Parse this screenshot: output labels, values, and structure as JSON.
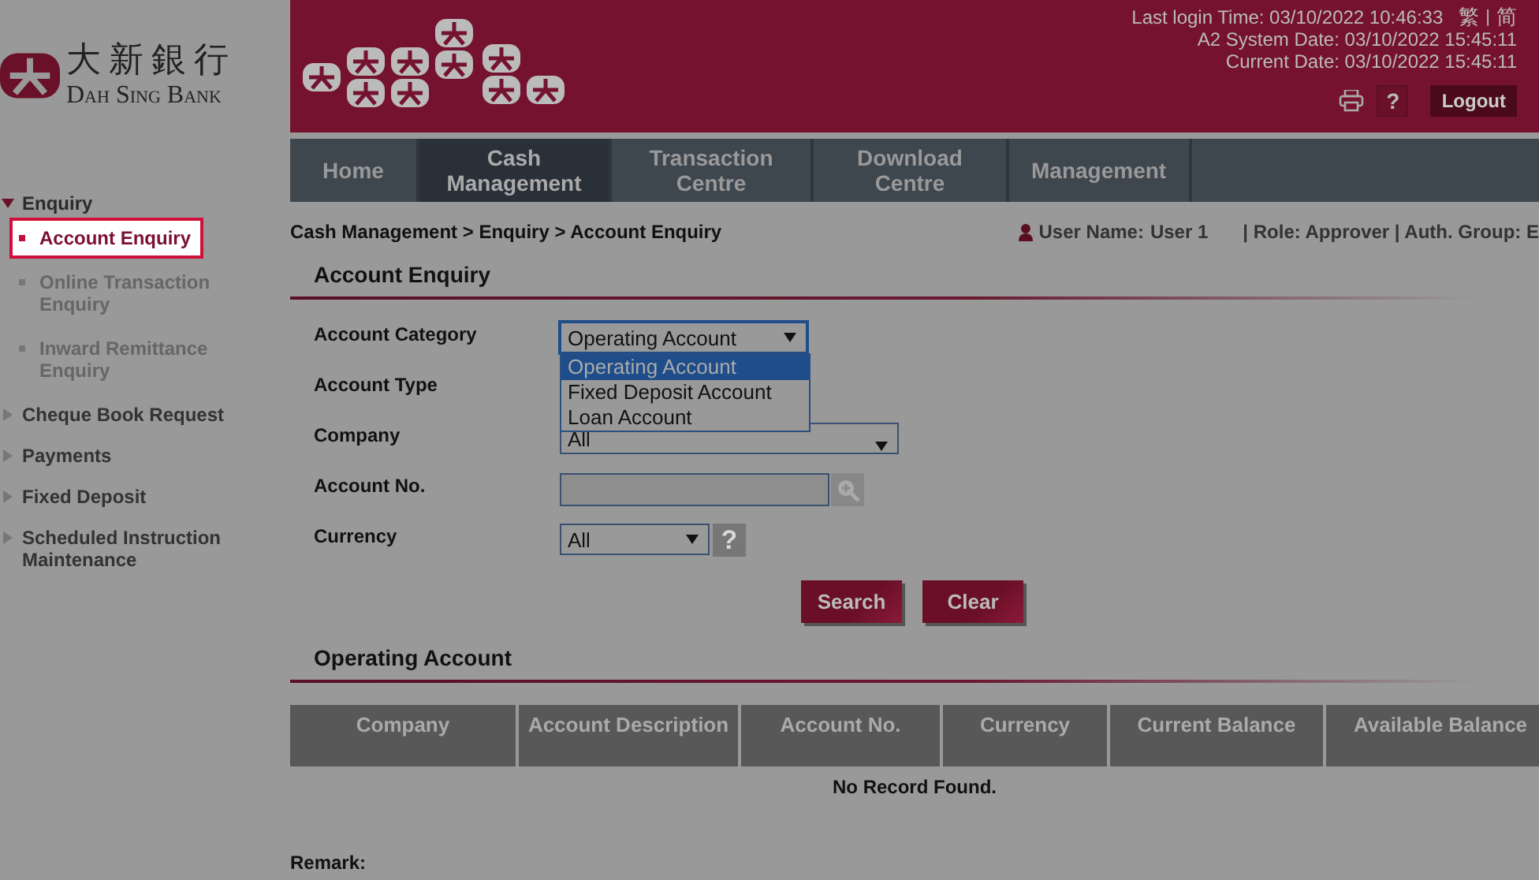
{
  "logo": {
    "chinese": "大新銀行",
    "english": "Dah Sing Bank"
  },
  "header": {
    "info": [
      "Last login Time: 03/10/2022 10:46:33",
      "A2 System Date: 03/10/2022 15:45:11",
      "Current Date: 03/10/2022 15:45:11"
    ],
    "languages": [
      "繁",
      "简"
    ],
    "language_separator": "|",
    "help": "?",
    "logout": "Logout"
  },
  "nav": [
    {
      "label": "Home",
      "selected": false
    },
    {
      "label": "Cash Management",
      "selected": true
    },
    {
      "label": "Transaction Centre",
      "selected": false
    },
    {
      "label": "Download Centre",
      "selected": false
    },
    {
      "label": "Management",
      "selected": false
    }
  ],
  "sidebar": {
    "items": [
      {
        "label": "Enquiry",
        "expanded": true,
        "children": [
          {
            "label": "Account Enquiry",
            "selected": true
          },
          {
            "label": "Online Transaction Enquiry",
            "selected": false
          },
          {
            "label": "Inward Remittance Enquiry",
            "selected": false
          }
        ]
      },
      {
        "label": "Cheque Book Request",
        "expanded": false
      },
      {
        "label": "Payments",
        "expanded": false
      },
      {
        "label": "Fixed Deposit",
        "expanded": false
      },
      {
        "label": "Scheduled Instruction Maintenance",
        "expanded": false
      }
    ]
  },
  "breadcrumb": "Cash Management > Enquiry > Account Enquiry",
  "user": {
    "label": "User Name:",
    "name": "User 1",
    "role": "| Role: Approver | Auth. Group: E"
  },
  "form": {
    "title": "Account Enquiry",
    "fields": [
      {
        "label": "Account Category",
        "kind": "select",
        "value": "Operating Account",
        "open": true,
        "options": [
          {
            "label": "Operating Account",
            "selected": true
          },
          {
            "label": "Fixed Deposit Account",
            "selected": false
          },
          {
            "label": "Loan Account",
            "selected": false
          }
        ]
      },
      {
        "label": "Account Type",
        "kind": "hidden"
      },
      {
        "label": "Company",
        "kind": "select",
        "value": "All",
        "open": false
      },
      {
        "label": "Account No.",
        "kind": "lookup"
      },
      {
        "label": "Currency",
        "kind": "select-help",
        "value": "All",
        "open": false,
        "help": "?"
      }
    ],
    "buttons": [
      "Search",
      "Clear"
    ]
  },
  "results": {
    "title": "Operating Account",
    "columns": [
      "Company",
      "Account Description",
      "Account No.",
      "Currency",
      "Current Balance",
      "Available Balance"
    ],
    "empty": "No Record Found."
  },
  "remark": "Remark:"
}
